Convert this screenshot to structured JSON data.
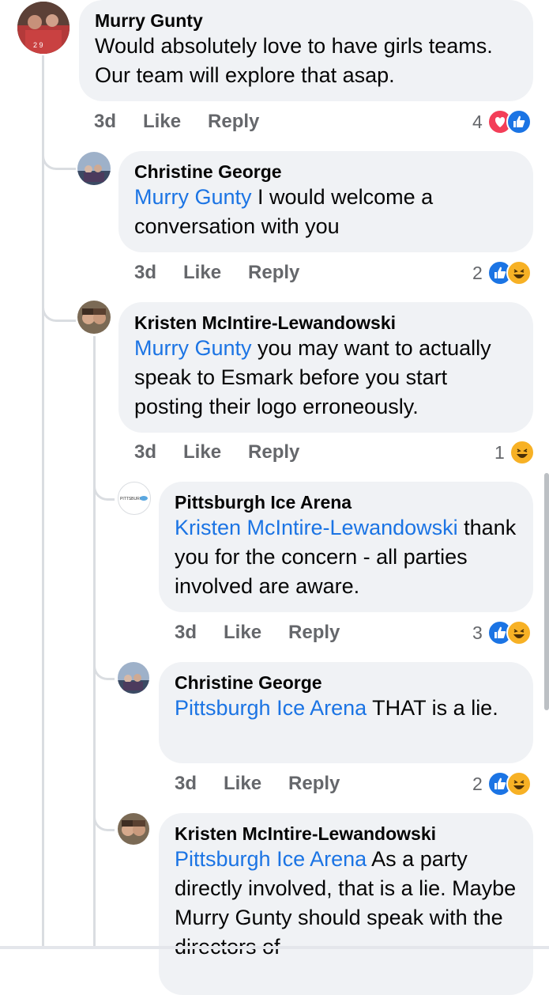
{
  "comments": [
    {
      "author": "Murry Gunty",
      "text": "Would absolutely love to have girls teams. Our team will explore that asap.",
      "time": "3d",
      "like": "Like",
      "reply": "Reply",
      "reaction_count": "4",
      "reactions": [
        "love-icon",
        "like-icon"
      ]
    },
    {
      "author": "Christine George",
      "mention": "Murry Gunty",
      "text": " I would welcome a conversation with you",
      "time": "3d",
      "like": "Like",
      "reply": "Reply",
      "reaction_count": "2",
      "reactions": [
        "like-icon",
        "haha-icon"
      ]
    },
    {
      "author": "Kristen McIntire-Lewandowski",
      "mention": "Murry Gunty",
      "text": " you may want to actually speak to Esmark before you start posting their logo erroneously.",
      "time": "3d",
      "like": "Like",
      "reply": "Reply",
      "reaction_count": "1",
      "reactions": [
        "haha-icon"
      ]
    },
    {
      "author": "Pittsburgh Ice Arena",
      "mention": "Kristen McIntire-Lewandowski",
      "text": " thank you for the concern - all parties involved are aware.",
      "time": "3d",
      "like": "Like",
      "reply": "Reply",
      "reaction_count": "3",
      "reactions": [
        "like-icon",
        "haha-icon"
      ],
      "avatar_text": "PITTSBURGH"
    },
    {
      "author": "Christine George",
      "mention": "Pittsburgh Ice Arena",
      "text": " THAT is a lie.",
      "time": "3d",
      "like": "Like",
      "reply": "Reply",
      "reaction_count": "2",
      "reactions": [
        "like-icon",
        "haha-icon"
      ]
    },
    {
      "author": "Kristen McIntire-Lewandowski",
      "mention": "Pittsburgh Ice Arena",
      "text": " As a party directly involved, that is a lie. Maybe Murry Gunty should speak with the directors of"
    }
  ],
  "colors": {
    "link": "#1b74e4",
    "bubble": "#f0f2f5",
    "meta": "#65676b"
  }
}
